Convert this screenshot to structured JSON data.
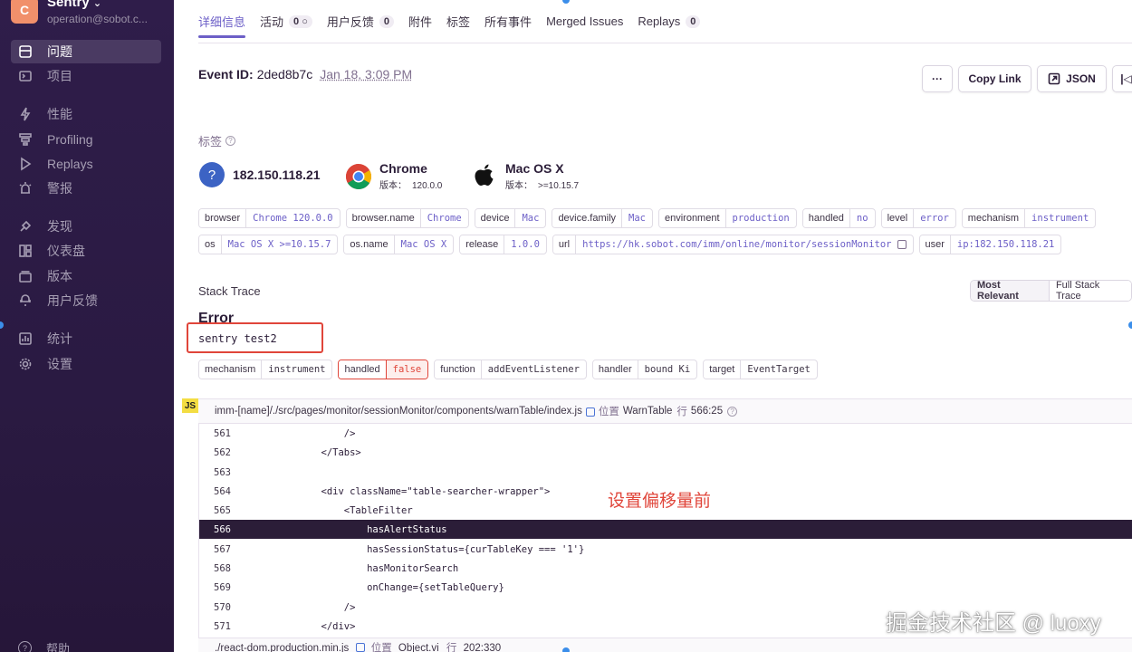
{
  "sidebar": {
    "org_initial": "C",
    "org_name": "Sentry",
    "org_email": "operation@sobot.c...",
    "items": [
      {
        "label": "问题",
        "icon": "issues-icon"
      },
      {
        "label": "项目",
        "icon": "projects-icon"
      },
      {
        "label": "性能",
        "icon": "performance-icon"
      },
      {
        "label": "Profiling",
        "icon": "profiling-icon"
      },
      {
        "label": "Replays",
        "icon": "replays-icon"
      },
      {
        "label": "警报",
        "icon": "alerts-icon"
      },
      {
        "label": "发现",
        "icon": "discover-icon"
      },
      {
        "label": "仪表盘",
        "icon": "dashboards-icon"
      },
      {
        "label": "版本",
        "icon": "releases-icon"
      },
      {
        "label": "用户反馈",
        "icon": "user-feedback-icon"
      },
      {
        "label": "统计",
        "icon": "stats-icon"
      },
      {
        "label": "设置",
        "icon": "settings-icon"
      }
    ],
    "help_label": "帮助"
  },
  "tabs": [
    {
      "label": "详细信息",
      "badge": ""
    },
    {
      "label": "活动",
      "badge": "0"
    },
    {
      "label": "用户反馈",
      "badge": "0"
    },
    {
      "label": "附件",
      "badge": ""
    },
    {
      "label": "标签",
      "badge": ""
    },
    {
      "label": "所有事件",
      "badge": ""
    },
    {
      "label": "Merged Issues",
      "badge": ""
    },
    {
      "label": "Replays",
      "badge": "0"
    }
  ],
  "event": {
    "id_label": "Event ID:",
    "id": "2ded8b7c",
    "date": "Jan 18, 3:09 PM"
  },
  "actions": {
    "more": "···",
    "copy_link": "Copy Link",
    "json": "JSON"
  },
  "tags_section": {
    "title": "标签",
    "context": {
      "ip": "182.150.118.21",
      "browser_name": "Chrome",
      "browser_version_key": "版本：",
      "browser_version": "120.0.0",
      "os_name": "Mac OS X",
      "os_version_key": "版本：",
      "os_version": ">=10.15.7"
    },
    "row1": [
      {
        "key": "browser",
        "value": "Chrome 120.0.0"
      },
      {
        "key": "browser.name",
        "value": "Chrome"
      },
      {
        "key": "device",
        "value": "Mac"
      },
      {
        "key": "device.family",
        "value": "Mac"
      },
      {
        "key": "environment",
        "value": "production"
      },
      {
        "key": "handled",
        "value": "no"
      },
      {
        "key": "level",
        "value": "error"
      },
      {
        "key": "mechanism",
        "value": "instrument"
      }
    ],
    "row2": [
      {
        "key": "os",
        "value": "Mac OS X >=10.15.7"
      },
      {
        "key": "os.name",
        "value": "Mac OS X"
      },
      {
        "key": "release",
        "value": "1.0.0"
      },
      {
        "key": "url",
        "value": "https://hk.sobot.com/imm/online/monitor/sessionMonitor"
      },
      {
        "key": "user",
        "value": "ip:182.150.118.21"
      }
    ]
  },
  "stack_trace": {
    "title": "Stack Trace",
    "toggle_most_relevant": "Most Relevant",
    "toggle_full": "Full Stack Trace",
    "error_type": "Error",
    "error_message": "sentry test2",
    "mechanism_tags": [
      {
        "key": "mechanism",
        "value": "instrument"
      },
      {
        "key": "handled",
        "value": "false"
      },
      {
        "key": "function",
        "value": "addEventListener"
      },
      {
        "key": "handler",
        "value": "bound Ki"
      },
      {
        "key": "target",
        "value": "EventTarget"
      }
    ],
    "frame": {
      "badge": "JS",
      "path": "imm-[name]/./src/pages/monitor/sessionMonitor/components/warnTable/index.js",
      "in_label": "位置",
      "function": "WarnTable",
      "line_label": "行",
      "position": "566:25"
    },
    "code_lines": [
      {
        "n": "561",
        "code": "                  />"
      },
      {
        "n": "562",
        "code": "              </Tabs>"
      },
      {
        "n": "563",
        "code": ""
      },
      {
        "n": "564",
        "code": "              <div className=\"table-searcher-wrapper\">"
      },
      {
        "n": "565",
        "code": "                  <TableFilter"
      },
      {
        "n": "566",
        "code": "                      hasAlertStatus"
      },
      {
        "n": "567",
        "code": "                      hasSessionStatus={curTableKey === '1'}"
      },
      {
        "n": "568",
        "code": "                      hasMonitorSearch"
      },
      {
        "n": "569",
        "code": "                      onChange={setTableQuery}"
      },
      {
        "n": "570",
        "code": "                  />"
      },
      {
        "n": "571",
        "code": "              </div>"
      }
    ],
    "next_frame": {
      "path": "./react-dom.production.min.js",
      "in_label": "位置",
      "function": "Object.vi",
      "line_label": "行",
      "position": "202:330"
    }
  },
  "annotation": "设置偏移量前",
  "watermark": "掘金技术社区 @ luoxy",
  "colors": {
    "accent": "#6c5fc7",
    "sidebar_bg": "#2f1d4a",
    "highlight_line": "#2b1d38",
    "annotation_red": "#e0453a"
  }
}
